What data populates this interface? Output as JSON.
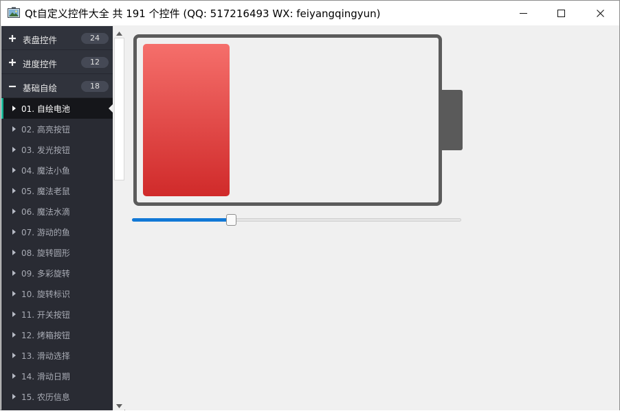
{
  "window": {
    "title": "Qt自定义控件大全 共 191 个控件 (QQ: 517216493 WX: feiyangqingyun)",
    "controls": [
      "minimize-icon",
      "maximize-icon",
      "close-icon"
    ]
  },
  "sidebar": {
    "groups": [
      {
        "sign": "+",
        "label": "表盘控件",
        "count": "24"
      },
      {
        "sign": "+",
        "label": "进度控件",
        "count": "12"
      },
      {
        "sign": "−",
        "label": "基础自绘",
        "count": "18"
      }
    ],
    "items": [
      {
        "label": "01. 自绘电池",
        "active": true
      },
      {
        "label": "02. 高亮按钮"
      },
      {
        "label": "03. 发光按钮"
      },
      {
        "label": "04. 魔法小鱼"
      },
      {
        "label": "05. 魔法老鼠"
      },
      {
        "label": "06. 魔法水滴"
      },
      {
        "label": "07. 游动的鱼"
      },
      {
        "label": "08. 旋转圆形"
      },
      {
        "label": "09. 多彩旋转"
      },
      {
        "label": "10. 旋转标识"
      },
      {
        "label": "11. 开关按钮"
      },
      {
        "label": "12. 烤箱按钮"
      },
      {
        "label": "13. 滑动选择"
      },
      {
        "label": "14. 滑动日期"
      },
      {
        "label": "15. 农历信息"
      }
    ],
    "accent_color": "#19b394"
  },
  "battery": {
    "level_percent": 30,
    "level_colors": [
      "#f56f6b",
      "#d02a2a"
    ],
    "border_color": "#5b5b5b"
  },
  "slider": {
    "value_percent": 30,
    "fill_color": "#1178d6"
  }
}
